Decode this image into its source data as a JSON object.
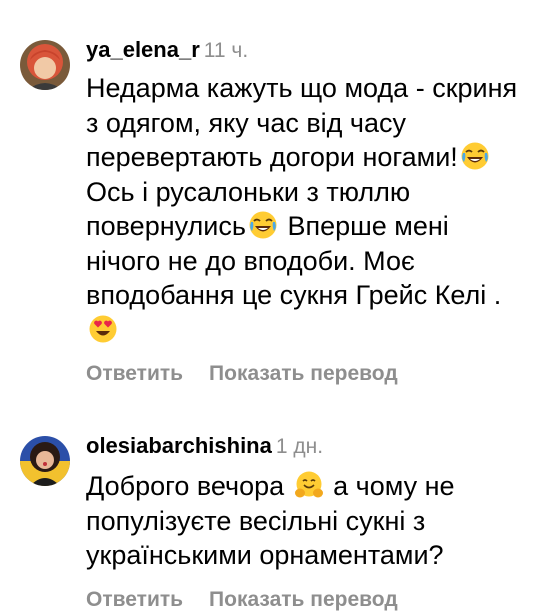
{
  "comments": [
    {
      "username": "ya_elena_r",
      "timestamp": "11 ч.",
      "text_parts": [
        "Недарма кажуть що мода - скриня з одягом, яку час від часу перевертають догори ногами!",
        " Ось і русалоньки з тюллю повернулись",
        " Вперше мені нічого не до вподоби. Моє вподобання це сукня Грейс Келі .",
        ""
      ],
      "emojis": [
        "laughing-tears-emoji",
        "laughing-tears-emoji",
        "heart-eyes-emoji"
      ],
      "actions": {
        "reply": "Ответить",
        "translate": "Показать перевод"
      }
    },
    {
      "username": "olesiabarchishina",
      "timestamp": "1 дн.",
      "text_parts": [
        "Доброго вечора ",
        " а чому не популізуєте весільні сукні з українськими орнаментами?"
      ],
      "emojis": [
        "hugging-face-emoji"
      ],
      "actions": {
        "reply": "Ответить",
        "translate": "Показать перевод"
      }
    }
  ],
  "colors": {
    "text": "#000000",
    "muted": "#8e8e8e",
    "background": "#ffffff"
  }
}
